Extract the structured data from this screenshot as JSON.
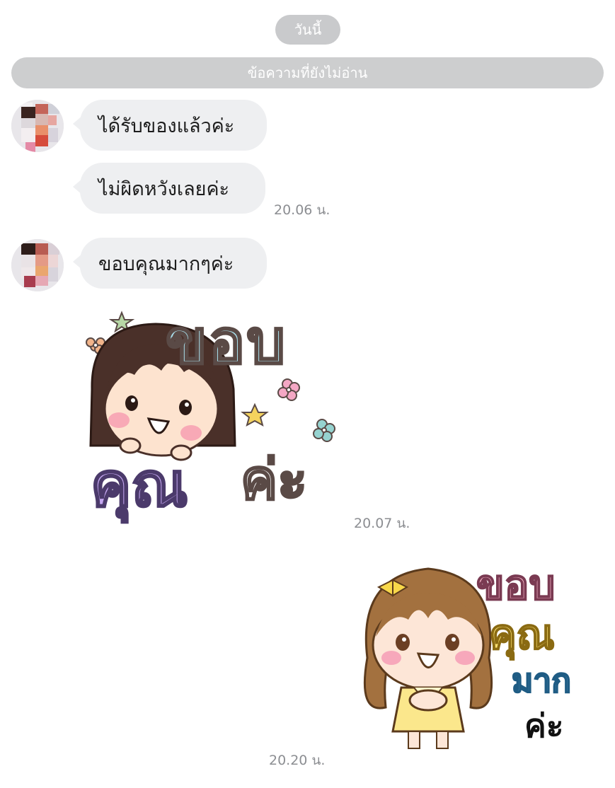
{
  "chat": {
    "date_divider": "วันนี้",
    "unread_divider": "ข้อความที่ยังไม่อ่าน",
    "messages": [
      {
        "text": "ได้รับของแล้วค่ะ"
      },
      {
        "text": "ไม่ผิดหวังเลยค่ะ",
        "time": "20.06 น."
      },
      {
        "text": "ขอบคุณมากๆค่ะ"
      },
      {
        "sticker": "thank-you-sticker-girl-blue-purple",
        "time": "20.07 น."
      },
      {
        "sticker": "thank-you-sticker-girl-yellow",
        "time": "20.20 น."
      }
    ],
    "stickers": {
      "left_line1": "ขอบ",
      "left_line2": "คุณ",
      "left_line3": "ค่ะ",
      "right_line1": "ขอบ",
      "right_line2": "คุณ",
      "right_line3": "มาก",
      "right_line4": "ค่ะ"
    }
  },
  "colors": {
    "bubble_bg": "#eeeff1",
    "divider_bg": "#cdcecf",
    "time_text": "#8c8e92"
  }
}
